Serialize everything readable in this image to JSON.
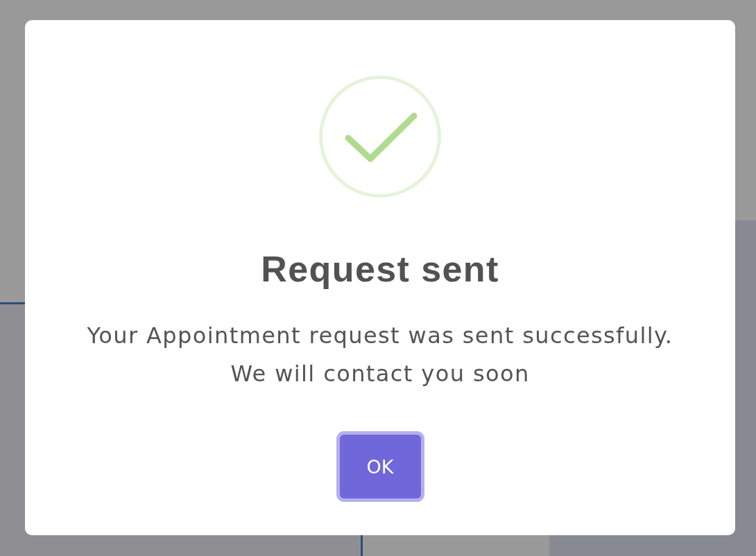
{
  "dialog": {
    "title": "Request sent",
    "message_lines": [
      "Your Appointment request was sent successfully.",
      "We will contact you soon"
    ],
    "buttons": [
      {
        "label": "OK",
        "focused": true
      }
    ]
  }
}
